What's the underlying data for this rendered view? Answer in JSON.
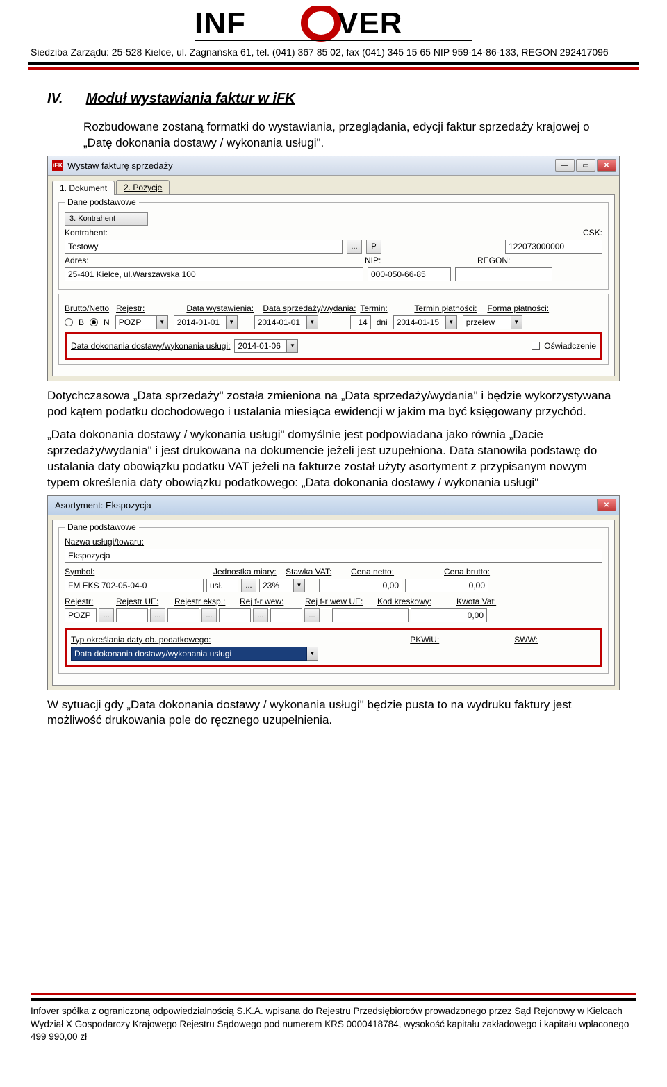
{
  "header": {
    "logo_text": "INFOVER",
    "address": "Siedziba Zarządu: 25-528 Kielce, ul. Zagnańska 61, tel. (041) 367 85 02, fax (041) 345 15 65  NIP 959-14-86-133, REGON 292417096"
  },
  "section": {
    "number": "IV.",
    "title": "Moduł wystawiania faktur w iFK",
    "p1": "Rozbudowane zostaną formatki do wystawiania, przeglądania, edycji faktur sprzedaży krajowej o  „Datę dokonania dostawy / wykonania usługi\".",
    "p2": "Dotychczasowa „Data sprzedaży\" została zmieniona na „Data sprzedaży/wydania\" i będzie wykorzystywana pod kątem podatku dochodowego i ustalania miesiąca ewidencji w jakim ma być księgowany przychód.",
    "p3": "„Data dokonania dostawy / wykonania usługi\" domyślnie jest podpowiadana jako równia „Dacie sprzedaży/wydania\" i jest drukowana na dokumencie jeżeli jest uzupełniona. Data stanowiła podstawę do ustalania daty obowiązku podatku VAT jeżeli na fakturze został użyty asortyment z przypisanym nowym typem określenia daty obowiązku podatkowego: „Data dokonania dostawy / wykonania usługi\"",
    "p4": "W sytuacji gdy „Data dokonania dostawy / wykonania usługi\" będzie pusta to na wydruku faktury jest możliwość drukowania pole do ręcznego uzupełnienia."
  },
  "win1": {
    "title": "Wystaw fakturę sprzedaży",
    "tab1": "1. Dokument",
    "tab2": "2. Pozycje",
    "group_dane": "Dane podstawowe",
    "btn_kontrahent": "3. Kontrahent",
    "lbl_kontrahent": "Kontrahent:",
    "val_kontrahent": "Testowy",
    "lbl_csk": "CSK:",
    "val_csk": "122073000000",
    "btn_dots": "...",
    "btn_p": "P",
    "lbl_adres": "Adres:",
    "val_adres": "25-401 Kielce, ul.Warszawska 100",
    "lbl_nip": "NIP:",
    "val_nip": "000-050-66-85",
    "lbl_regon": "REGON:",
    "val_regon": "",
    "lbl_brutto_netto": "Brutto/Netto",
    "radio_b": "B",
    "radio_n": "N",
    "lbl_rejestr": "Rejestr:",
    "val_rejestr": "POZP",
    "lbl_data_wyst": "Data wystawienia:",
    "val_data_wyst": "2014-01-01",
    "lbl_data_sprz": "Data sprzedaży/wydania:",
    "val_data_sprz": "2014-01-01",
    "lbl_termin": "Termin:",
    "val_termin": "14",
    "lbl_dni": "dni",
    "lbl_termin_plat": "Termin płatności:",
    "val_termin_plat": "2014-01-15",
    "lbl_forma_plat": "Forma płatności:",
    "val_forma_plat": "przelew",
    "lbl_data_dostawy": "Data dokonania dostawy/wykonania usługi:",
    "val_data_dostawy": "2014-01-06",
    "lbl_oswiad": "Oświadczenie"
  },
  "win2": {
    "title": "Asortyment: Ekspozycja",
    "group_dane": "Dane podstawowe",
    "lbl_nazwa": "Nazwa usługi/towaru:",
    "val_nazwa": "Ekspozycja",
    "lbl_symbol": "Symbol:",
    "val_symbol": "FM EKS 702-05-04-0",
    "lbl_jm": "Jednostka miary:",
    "val_jm": "usł.",
    "lbl_vat": "Stawka VAT:",
    "val_vat": "23%",
    "lbl_cena_netto": "Cena netto:",
    "val_cena_netto": "0,00",
    "lbl_cena_brutto": "Cena brutto:",
    "val_cena_brutto": "0,00",
    "lbl_rej": "Rejestr:",
    "val_rej": "POZP",
    "lbl_rej_ue": "Rejestr UE:",
    "lbl_rej_eksp": "Rejestr eksp.:",
    "lbl_rej_fr_wew": "Rej f-r wew:",
    "lbl_rej_fr_wew_ue": "Rej f-r wew UE:",
    "lbl_kod": "Kod kreskowy:",
    "lbl_kwota_vat": "Kwota Vat:",
    "val_kwota_vat": "0,00",
    "lbl_typ": "Typ określania daty ob. podatkowego:",
    "val_typ": "Data dokonania dostawy/wykonania usługi",
    "lbl_pkwiu": "PKWiU:",
    "lbl_sww": "SWW:"
  },
  "footer": {
    "line1": "Infover  spółka z ograniczoną odpowiedzialnością S.K.A.  wpisana do  Rejestru Przedsiębiorców prowadzonego przez Sąd Rejonowy w Kielcach Wydział X Gospodarczy Krajowego Rejestru Sądowego pod numerem KRS 0000418784, wysokość kapitału zakładowego i kapitału wpłaconego 499 990,00 zł"
  }
}
